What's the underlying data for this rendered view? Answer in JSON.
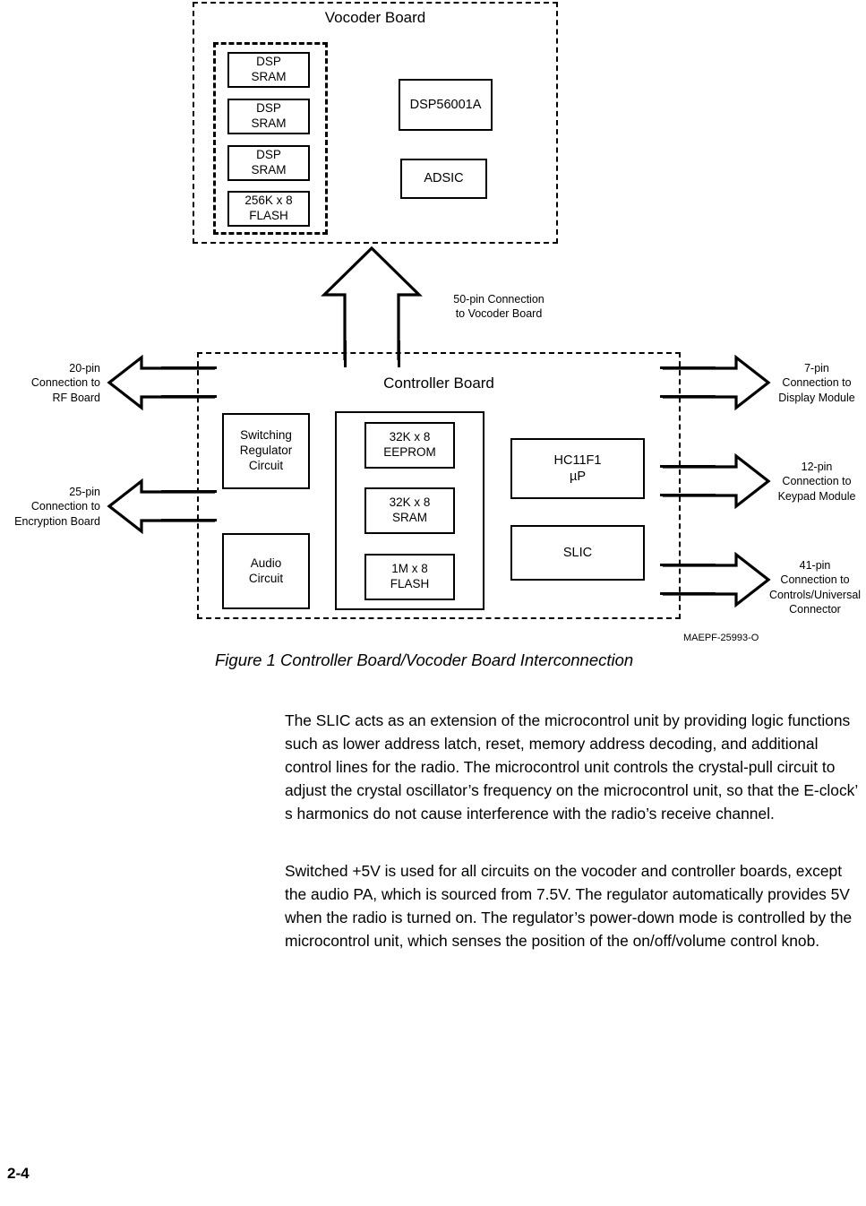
{
  "page": {
    "number": "2-4"
  },
  "figure": {
    "caption": "Figure 1 Controller Board/Vocoder Board Interconnection",
    "art_code": "MAEPF-25993-O",
    "vocoder_board": {
      "title": "Vocoder Board",
      "memory_group": [
        {
          "label": "DSP\nSRAM"
        },
        {
          "label": "DSP\nSRAM"
        },
        {
          "label": "DSP\nSRAM"
        },
        {
          "label": "256K x 8\nFLASH"
        }
      ],
      "components": [
        {
          "label": "DSP56001A"
        },
        {
          "label": "ADSIC"
        }
      ]
    },
    "controller_board": {
      "title": "Controller Board",
      "left_components": [
        {
          "label": "Switching\nRegulator\nCircuit"
        },
        {
          "label": "Audio\nCircuit"
        }
      ],
      "memory_group": [
        {
          "label": "32K x 8\nEEPROM"
        },
        {
          "label": "32K x 8\nSRAM"
        },
        {
          "label": "1M x 8\nFLASH"
        }
      ],
      "right_components": [
        {
          "label": "HC11F1\nµP"
        },
        {
          "label": "SLIC"
        }
      ]
    },
    "interboard_connector": {
      "label": "50-pin Connection\nto Vocoder Board"
    },
    "left_connectors": [
      {
        "label": "20-pin\nConnection to\nRF Board"
      },
      {
        "label": "25-pin\nConnection to\nEncryption Board"
      }
    ],
    "right_connectors": [
      {
        "label": "7-pin\nConnection to\nDisplay Module"
      },
      {
        "label": "12-pin\nConnection to\nKeypad Module"
      },
      {
        "label": "41-pin\nConnection to\nControls/Universal\nConnector"
      }
    ]
  },
  "body": {
    "paragraph_1": " The SLIC acts as an extension of the microcontrol unit by providing logic functions such as lower address latch, reset, memory address decoding, and additional control lines for the radio. The microcontrol unit controls the crystal-pull circuit to adjust the crystal oscillator’s frequency on the microcontrol unit, so that the E-clock’ s harmonics do not cause interference with the radio’s receive channel.",
    "paragraph_2": "Switched +5V is used for all circuits on the vocoder and controller boards, except the audio PA, which is sourced from 7.5V. The regulator automatically provides 5V when the radio is turned on. The regulator’s power-down mode is controlled by the microcontrol unit, which senses the position of the on/off/volume control knob."
  }
}
